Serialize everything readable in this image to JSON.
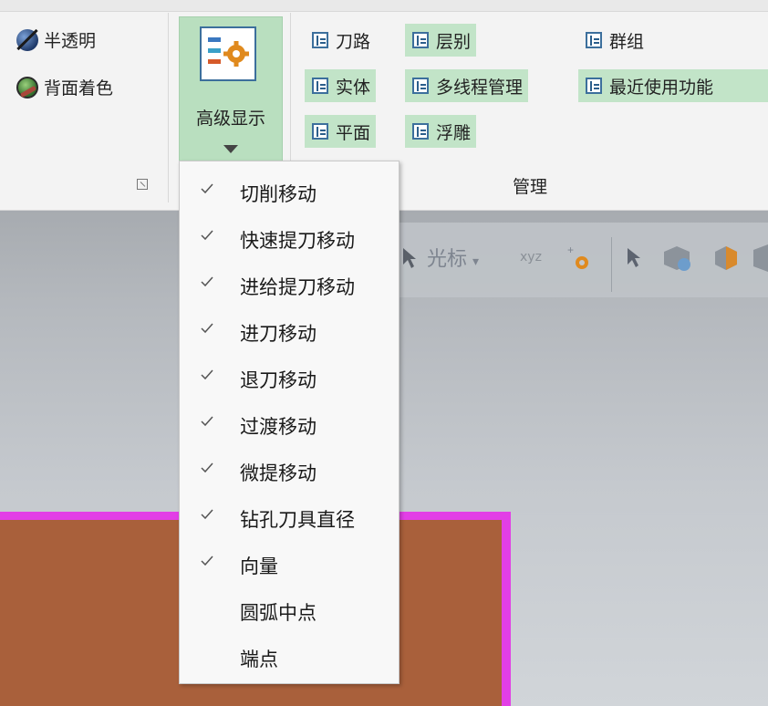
{
  "ribbon": {
    "left_buttons": [
      {
        "label": "半透明",
        "icon": "translucent-sphere-icon"
      },
      {
        "label": "背面着色",
        "icon": "backface-shading-icon"
      }
    ],
    "advanced_display": {
      "label": "高级显示",
      "icon": "advanced-display-settings-icon"
    },
    "manage_buttons": [
      {
        "label": "刀路",
        "active": false
      },
      {
        "label": "层别",
        "active": true
      },
      {
        "label": "群组",
        "active": false
      },
      {
        "label": "实体",
        "active": true
      },
      {
        "label": "多线程管理",
        "active": true
      },
      {
        "label": "最近使用功能",
        "active": true
      },
      {
        "label": "平面",
        "active": true
      },
      {
        "label": "浮雕",
        "active": true
      }
    ],
    "manage_group_label": "管理"
  },
  "viewport_toolbar": {
    "cursor_label": "光标",
    "xyz_label": "xyz"
  },
  "dropdown_menu": {
    "items": [
      {
        "label": "切削移动",
        "checked": true
      },
      {
        "label": "快速提刀移动",
        "checked": true
      },
      {
        "label": "进给提刀移动",
        "checked": true
      },
      {
        "label": "进刀移动",
        "checked": true
      },
      {
        "label": "退刀移动",
        "checked": true
      },
      {
        "label": "过渡移动",
        "checked": true
      },
      {
        "label": "微提移动",
        "checked": true
      },
      {
        "label": "钻孔刀具直径",
        "checked": true
      },
      {
        "label": "向量",
        "checked": true
      },
      {
        "label": "圆弧中点",
        "checked": false
      },
      {
        "label": "端点",
        "checked": false
      }
    ]
  },
  "colors": {
    "accent_green": "#c2e4c8",
    "shape_fill": "#a9603b",
    "shape_outline": "#e23fe6"
  }
}
